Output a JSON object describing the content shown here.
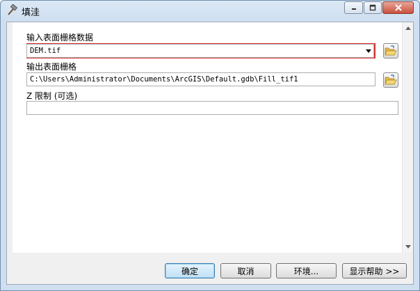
{
  "window": {
    "title": "填洼",
    "icon": "hammer-icon"
  },
  "form": {
    "input_raster": {
      "label": "输入表面栅格数据",
      "value": "DEM.tif",
      "highlight_color": "#d9312b"
    },
    "output_raster": {
      "label": "输出表面栅格",
      "value": "C:\\Users\\Administrator\\Documents\\ArcGIS\\Default.gdb\\Fill_tif1"
    },
    "z_limit": {
      "label": "Z 限制 (可选)",
      "value": ""
    }
  },
  "buttons": {
    "ok": "确定",
    "cancel": "取消",
    "environments": "环境...",
    "show_help": "显示帮助 >>"
  }
}
